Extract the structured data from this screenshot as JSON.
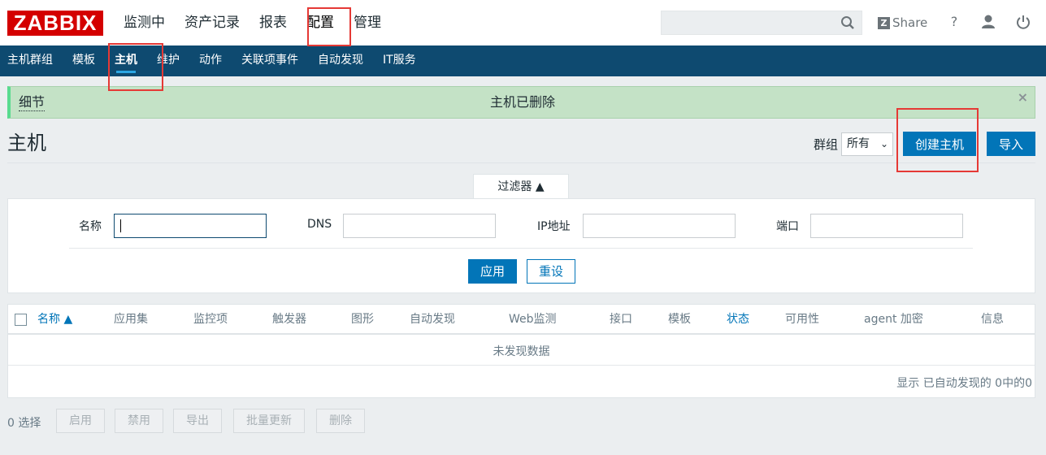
{
  "logo": "ZABBIX",
  "top_nav": [
    "监测中",
    "资产记录",
    "报表",
    "配置",
    "管理"
  ],
  "header": {
    "search_placeholder": "",
    "share": "Share",
    "help": "?"
  },
  "sub_nav": [
    "主机群组",
    "模板",
    "主机",
    "维护",
    "动作",
    "关联项事件",
    "自动发现",
    "IT服务"
  ],
  "message": {
    "details": "细节",
    "text": "主机已删除",
    "close": "×"
  },
  "page": {
    "title": "主机",
    "group_label": "群组",
    "group_value": "所有",
    "create_button": "创建主机",
    "import_button": "导入"
  },
  "filter": {
    "tab": "过滤器 ▲",
    "name_label": "名称",
    "name_value": "",
    "dns_label": "DNS",
    "dns_value": "",
    "ip_label": "IP地址",
    "ip_value": "",
    "port_label": "端口",
    "port_value": "",
    "apply": "应用",
    "reset": "重设"
  },
  "table": {
    "columns": [
      "名称 ▲",
      "应用集",
      "监控项",
      "触发器",
      "图形",
      "自动发现",
      "Web监测",
      "接口",
      "模板",
      "状态",
      "可用性",
      "agent 加密",
      "信息"
    ],
    "no_data": "未发现数据",
    "paging": "显示 已自动发现的 0中的0"
  },
  "footer": {
    "selected": "0 选择",
    "buttons": [
      "启用",
      "禁用",
      "导出",
      "批量更新",
      "删除"
    ]
  },
  "colors": {
    "accent": "#0275b8",
    "nav_bg": "#0e4a70",
    "logo": "#d40000",
    "success_bg": "#c4e2c6",
    "highlight": "#e53935"
  }
}
